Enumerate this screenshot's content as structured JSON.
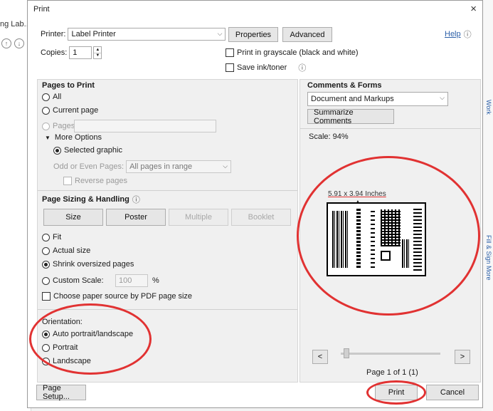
{
  "background": {
    "tab_label": "ng Lab...",
    "up_arrow": "↑",
    "down_arrow": "↓"
  },
  "dialog": {
    "title": "Print",
    "close_glyph": "×",
    "printer_label": "Printer:",
    "printer_value": "Label Printer",
    "properties_label": "Properties",
    "advanced_label": "Advanced",
    "help_label": "Help",
    "copies_label": "Copies:",
    "copies_value": "1",
    "grayscale_label": "Print in grayscale (black and white)",
    "save_ink_label": "Save ink/toner",
    "info_glyph": "ⓘ"
  },
  "pages_to_print": {
    "title": "Pages to Print",
    "all_label": "All",
    "current_label": "Current page",
    "pages_label": "Pages",
    "pages_value": "",
    "more_options_label": "More Options",
    "selected_graphic_label": "Selected graphic",
    "odd_even_label": "Odd or Even Pages:",
    "odd_even_value": "All pages in range",
    "reverse_label": "Reverse pages"
  },
  "page_sizing": {
    "title": "Page Sizing & Handling",
    "info_glyph": "ⓘ",
    "size_label": "Size",
    "poster_label": "Poster",
    "multiple_label": "Multiple",
    "booklet_label": "Booklet",
    "fit_label": "Fit",
    "actual_label": "Actual size",
    "shrink_label": "Shrink oversized pages",
    "custom_label": "Custom Scale:",
    "custom_value": "100",
    "percent": "%",
    "paper_source_label": "Choose paper source by PDF page size"
  },
  "orientation": {
    "title": "Orientation:",
    "auto_label": "Auto portrait/landscape",
    "portrait_label": "Portrait",
    "landscape_label": "Landscape"
  },
  "comments_forms": {
    "title": "Comments & Forms",
    "value": "Document and Markups",
    "summarize_label": "Summarize Comments"
  },
  "preview": {
    "scale_label": "Scale: 94%",
    "dimensions": "5.91 x 3.94 Inches",
    "page_indicator": "Page 1 of 1 (1)",
    "prev_glyph": "<",
    "next_glyph": ">"
  },
  "footer": {
    "page_setup_label": "Page Setup...",
    "print_label": "Print",
    "cancel_label": "Cancel"
  },
  "right_sidebar": {
    "top_text": "Work",
    "middle_text": "Fill & Sign More"
  },
  "colors": {
    "annotation_red": "#e13232",
    "link_blue": "#2b5fa8"
  }
}
